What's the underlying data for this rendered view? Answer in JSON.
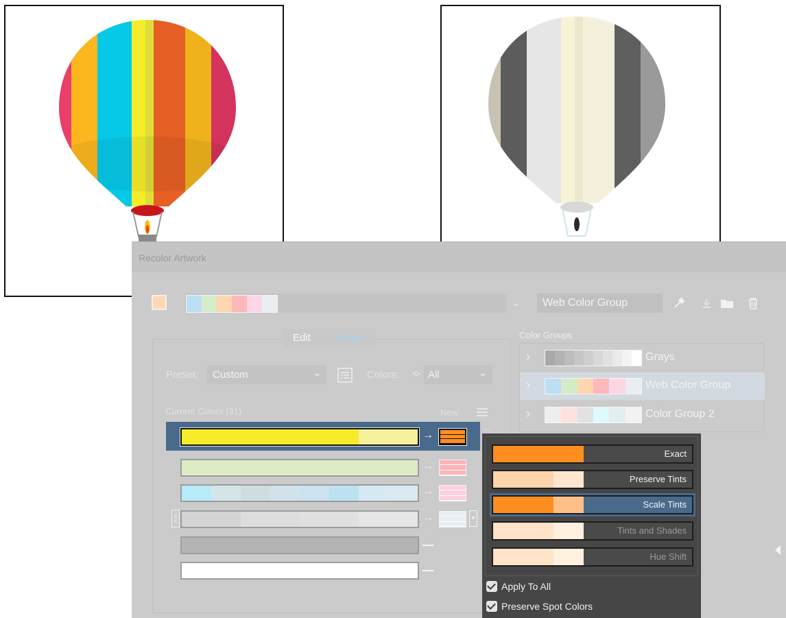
{
  "window": {
    "title": "Recolor Artwork"
  },
  "colors": {
    "yellow": "#f6ec2a",
    "orange": "#fd8e1f",
    "panel_bg": "#cbcbcb",
    "selection": "#4a6a8c",
    "menu_bg": "#464646"
  },
  "top_bar": {
    "active_color_swatch": "#ffd7b0",
    "harmony_colors": [
      "#bddff4",
      "#d6ecc8",
      "#fed6b0",
      "#fdb8bb",
      "#fdd6e5",
      "#e8eef1"
    ],
    "group_name_value": "Web Color Group",
    "icons": [
      "chevron-down-icon",
      "eyedropper-icon",
      "save-icon",
      "folder-icon",
      "trash-icon"
    ]
  },
  "tabs": {
    "edit_label": "Edit",
    "assign_label": "Assign",
    "active": "Assign"
  },
  "preset": {
    "label": "Preset:",
    "value": "Custom"
  },
  "colors_ctrl": {
    "label": "Colors:",
    "value": "All"
  },
  "current_colors": {
    "header": "Current Colors (31)",
    "new_label": "New"
  },
  "rows": [
    {
      "segments": [
        "#f6ec2a",
        "#f6ec2a",
        "#f6ec2a",
        "#f6ec2a",
        "#f6ec2a",
        "#f6ec2a",
        "#f5f19a",
        "#f5f19a"
      ],
      "new": "#fd8e1f",
      "selected": true
    },
    {
      "segments": [
        "#deecc4"
      ],
      "new": "#fbb4b8"
    },
    {
      "segments": [
        "#b7ebf7",
        "#d6e5ea",
        "#cfdde3",
        "#d2e2ea",
        "#cbe2f0",
        "#bde1f1",
        "#d5eaf4",
        "#dbe9f0"
      ],
      "new": "#fdcfe0"
    },
    {
      "segments": [
        "#d4d4d4",
        "#dddddd",
        "#e0e0e0",
        "#e6e6e6"
      ],
      "new": "#e9eef2"
    },
    {
      "segments": [
        "#b4b4b4"
      ],
      "new": null
    },
    {
      "segments": [
        "#ffffff"
      ],
      "new": null
    }
  ],
  "color_groups": {
    "header": "Color Groups",
    "items": [
      {
        "name": "Grays",
        "swatches": [
          "#a9a9a9",
          "#b3b3b3",
          "#bdbdbd",
          "#c6c6c6",
          "#cfcfcf",
          "#d8d8d8",
          "#e1e1e1",
          "#eaeaea",
          "#f3f3f3",
          "#ffffff"
        ]
      },
      {
        "name": "Web Color Group",
        "swatches": [
          "#bddff4",
          "#d6ecc8",
          "#fed6b0",
          "#fdb8bb",
          "#fdd6e5",
          "#e8eef1"
        ],
        "selected": true
      },
      {
        "name": "Color Group 2",
        "swatches": [
          "#eeeeee",
          "#fde2df",
          "#e2e2e2",
          "#ddfbfd",
          "#e4eeee",
          "#f2f2f2"
        ]
      }
    ]
  },
  "coloring_menu": {
    "options": [
      {
        "label": "Exact",
        "swatches": [
          "#fd8e1f"
        ],
        "enabled": true
      },
      {
        "label": "Preserve Tints",
        "swatches": [
          "#fed4ad",
          "#fed4ad",
          "#fee6cf"
        ],
        "enabled": true
      },
      {
        "label": "Scale Tints",
        "swatches": [
          "#fd8e1f",
          "#fd8e1f",
          "#fec088"
        ],
        "enabled": true,
        "selected": true
      },
      {
        "label": "Tints and Shades",
        "swatches": [
          "#fee3c8",
          "#fee3c8",
          "#fff0e0"
        ],
        "enabled": false
      },
      {
        "label": "Hue Shift",
        "swatches": [
          "#fee3c8",
          "#fee3c8",
          "#fff0e0"
        ],
        "enabled": false
      }
    ],
    "apply_to_all_label": "Apply To All",
    "apply_to_all_checked": true,
    "preserve_spot_label": "Preserve Spot Colors",
    "preserve_spot_checked": true
  }
}
